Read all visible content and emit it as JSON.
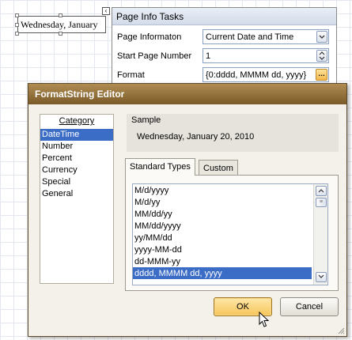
{
  "report": {
    "label_text": "Wednesday, January",
    "smart_tag_glyph": "‹"
  },
  "tasks_panel": {
    "title": "Page Info Tasks",
    "rows": [
      {
        "label": "Page Informaton",
        "value": "Current Date and Time",
        "button": "dropdown"
      },
      {
        "label": "Start Page Number",
        "value": "1",
        "button": "spinner"
      },
      {
        "label": "Format",
        "value": "{0:dddd, MMMM dd, yyyy}",
        "button": "ellipsis"
      }
    ]
  },
  "dialog": {
    "title": "FormatString Editor",
    "category_header": "Category",
    "categories": [
      "DateTime",
      "Number",
      "Percent",
      "Currency",
      "Special",
      "General"
    ],
    "selected_category": "DateTime",
    "sample_label": "Sample",
    "sample_value": "Wednesday, January 20, 2010",
    "tabs": [
      "Standard Types",
      "Custom"
    ],
    "active_tab": "Standard Types",
    "types": [
      "M/d/yyyy",
      "M/d/yy",
      "MM/dd/yy",
      "MM/dd/yyyy",
      "yy/MM/dd",
      "yyyy-MM-dd",
      "dd-MMM-yy",
      "dddd, MMMM dd, yyyy"
    ],
    "selected_type": "dddd, MMMM dd, yyyy",
    "ok_label": "OK",
    "cancel_label": "Cancel"
  },
  "colors": {
    "title_bar": "#7a5a29",
    "selection": "#3b6cc6",
    "ok_button": "#f6c55a"
  },
  "icons": {
    "dropdown": "chevron-down-icon",
    "spinner": "spin-up-down-icon",
    "ellipsis": "ellipsis-icon",
    "cursor": "mouse-pointer-icon"
  }
}
